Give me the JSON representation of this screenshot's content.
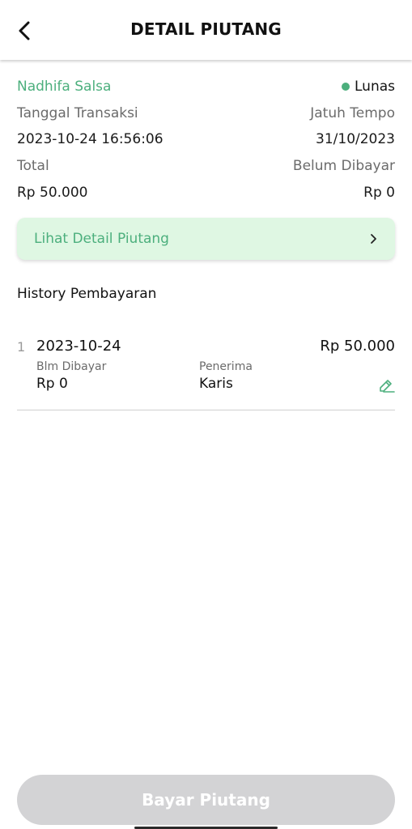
{
  "header": {
    "title": "DETAIL PIUTANG",
    "back_icon": "chevron-left-icon"
  },
  "summary": {
    "customer_name": "Nadhifa Salsa",
    "status": "Lunas",
    "status_color": "#4caf7d",
    "transaction_date_label": "Tanggal Transaksi",
    "due_date_label": "Jatuh Tempo",
    "transaction_date": "2023-10-24 16:56:06",
    "due_date": "31/10/2023",
    "total_label": "Total",
    "unpaid_label": "Belum Dibayar",
    "total": "Rp 50.000",
    "unpaid": "Rp 0"
  },
  "detail_card": {
    "label": "Lihat Detail Piutang",
    "chevron_icon": "chevron-right-icon",
    "background": "#dff7e3"
  },
  "history": {
    "title": "History Pembayaran",
    "items": [
      {
        "index": "1",
        "date": "2023-10-24",
        "amount": "Rp 50.000",
        "unpaid_label": "Blm Dibayar",
        "unpaid": "Rp 0",
        "receiver_label": "Penerima",
        "receiver": "Karis",
        "edit_icon": "pencil-edit-icon"
      }
    ]
  },
  "footer": {
    "pay_button_label": "Bayar Piutang",
    "pay_button_color": "#d3d3d5"
  },
  "colors": {
    "accent_green": "#4caf7d"
  }
}
